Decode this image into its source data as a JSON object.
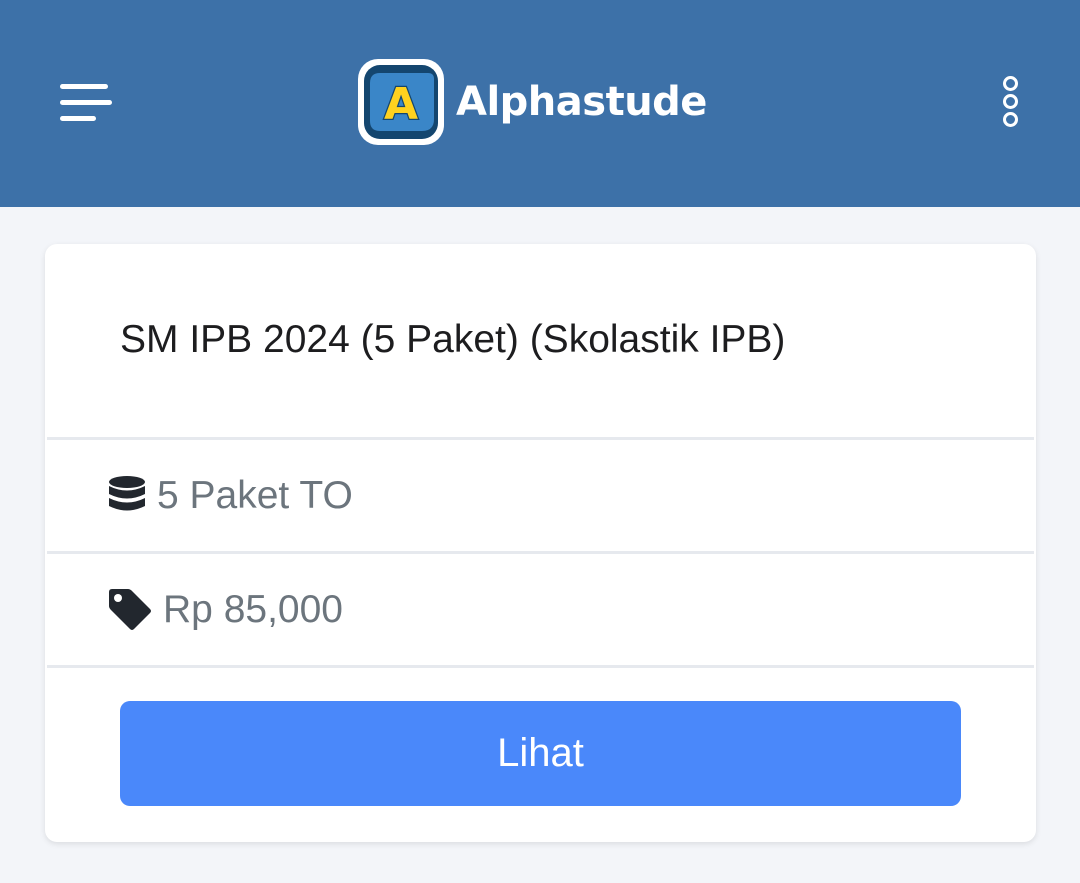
{
  "header": {
    "brand_name": "Alphastude",
    "logo_letter": "A",
    "menu_icon": "hamburger-menu-icon",
    "more_icon": "kebab-more-icon",
    "background_color": "#3d71a8"
  },
  "product": {
    "title": "SM IPB 2024 (5 Paket) (Skolastik IPB)",
    "package_count_icon": "database-icon",
    "package_count_text": "5 Paket TO",
    "price_icon": "price-tag-icon",
    "price_text": "Rp 85,000",
    "view_button_label": "Lihat",
    "button_color": "#4a88fa"
  }
}
